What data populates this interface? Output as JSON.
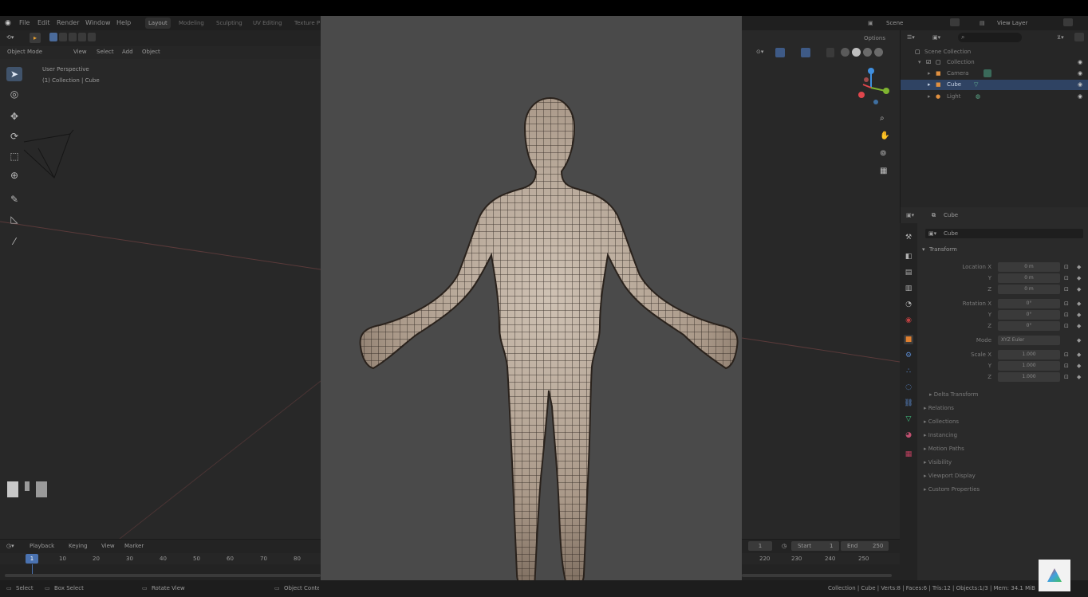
{
  "menubar": {
    "menus": [
      "File",
      "Edit",
      "Render",
      "Window",
      "Help"
    ],
    "workspaces": [
      "Layout",
      "Modeling",
      "Sculpting",
      "UV Editing",
      "Texture P"
    ],
    "active_workspace": "Layout",
    "scene_label": "Scene",
    "view_layer_label": "View Layer"
  },
  "viewport": {
    "mode": "Object Mode",
    "menus": [
      "View",
      "Select",
      "Add",
      "Object"
    ],
    "overlay_title": "User Perspective",
    "overlay_sub": "(1) Collection | Cube",
    "options_label": "Options"
  },
  "tools": [
    "select",
    "cursor",
    "move",
    "rotate",
    "scale",
    "transform",
    "annotate",
    "measure",
    "add-cube"
  ],
  "outliner": {
    "root": "Scene Collection",
    "rows": [
      {
        "label": "Collection",
        "selected": false
      },
      {
        "label": "Camera",
        "selected": false
      },
      {
        "label": "Cube",
        "selected": true
      },
      {
        "label": "Light",
        "selected": false
      }
    ]
  },
  "properties": {
    "object_name": "Cube",
    "datablock_name": "Cube",
    "transform_header": "Transform",
    "location_label": "Location X",
    "rotation_label": "Rotation X",
    "mode_label": "Mode",
    "mode_value": "XYZ Euler",
    "scale_label": "Scale X",
    "axis_y": "Y",
    "axis_z": "Z",
    "location": [
      "0 m",
      "0 m",
      "0 m"
    ],
    "rotation": [
      "0°",
      "0°",
      "0°"
    ],
    "scale": [
      "1.000",
      "1.000",
      "1.000"
    ],
    "sections": [
      "Delta Transform",
      "Relations",
      "Collections",
      "Instancing",
      "Motion Paths",
      "Visibility",
      "Viewport Display",
      "Custom Properties"
    ]
  },
  "timeline": {
    "menus": [
      "Playback",
      "Keying",
      "View",
      "Marker"
    ],
    "current_frame": "1",
    "ticks_left": [
      "10",
      "20",
      "30",
      "40",
      "50",
      "60",
      "70",
      "80"
    ],
    "ticks_right": [
      "220",
      "230",
      "240",
      "250"
    ],
    "start_label": "Start",
    "start_value": "1",
    "end_label": "End",
    "end_value": "250",
    "frame_field": "1"
  },
  "statusbar": {
    "left": [
      "Select",
      "Box Select",
      "Rotate View",
      "Object Context Menu"
    ],
    "right": "Collection | Cube | Verts:8 | Faces:6 | Tris:12 | Objects:1/3 | Mem: 34.1 MiB"
  },
  "colors": {
    "accent": "#40536b",
    "selection": "#2f4363",
    "axis_x": "#e0464c",
    "axis_y": "#7fb430",
    "axis_z": "#3f8fe0"
  }
}
